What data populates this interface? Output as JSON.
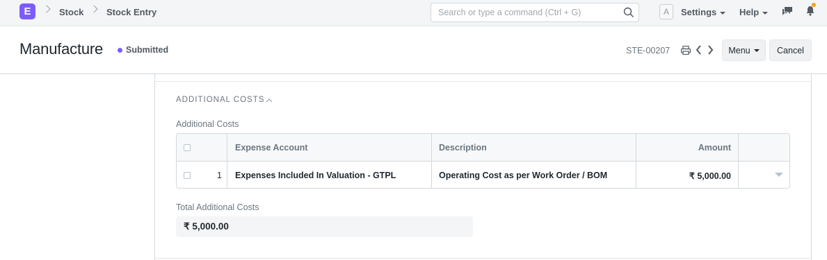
{
  "navbar": {
    "logo_letter": "E",
    "breadcrumbs": [
      "Stock",
      "Stock Entry"
    ],
    "search_placeholder": "Search or type a command (Ctrl + G)",
    "avatar_letter": "A",
    "settings_label": "Settings",
    "help_label": "Help",
    "icons": [
      "search-icon",
      "chat-icon",
      "bell-icon"
    ]
  },
  "page": {
    "title": "Manufacture",
    "status": "Submitted",
    "status_color": "#7c5cff",
    "doc_name": "STE-00207",
    "menu_label": "Menu",
    "cancel_label": "Cancel"
  },
  "section": {
    "title": "ADDITIONAL COSTS",
    "table_label": "Additional Costs",
    "columns": [
      "Expense Account",
      "Description",
      "Amount"
    ],
    "rows": [
      {
        "idx": "1",
        "expense_account": "Expenses Included In Valuation - GTPL",
        "description": "Operating Cost as per Work Order / BOM",
        "amount": "₹ 5,000.00"
      }
    ],
    "total_label": "Total Additional Costs",
    "total_value": "₹ 5,000.00"
  }
}
